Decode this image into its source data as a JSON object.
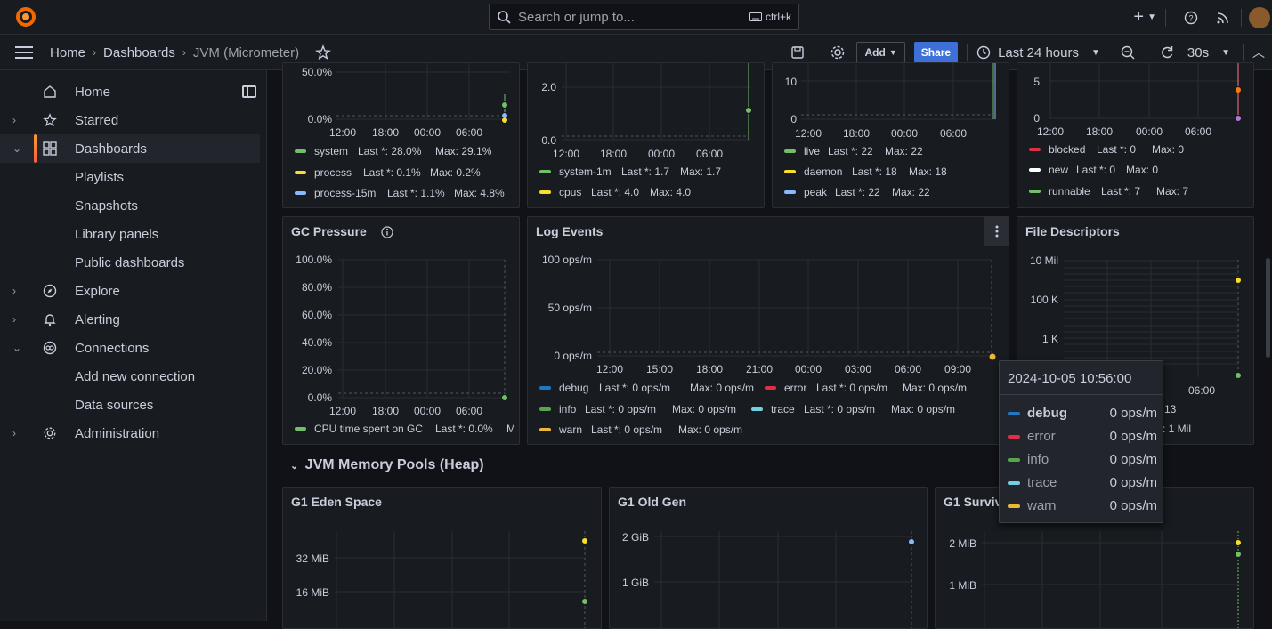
{
  "topbar": {
    "search_placeholder": "Search or jump to...",
    "search_shortcut": "ctrl+k"
  },
  "breadcrumb": {
    "home": "Home",
    "dashboards": "Dashboards",
    "current": "JVM (Micrometer)"
  },
  "toolbar": {
    "add_label": "Add",
    "share_label": "Share",
    "time_range": "Last 24 hours",
    "refresh_interval": "30s"
  },
  "sidebar": {
    "items": [
      {
        "label": "Home",
        "icon": "home-icon"
      },
      {
        "label": "Starred",
        "icon": "star-icon"
      },
      {
        "label": "Dashboards",
        "icon": "dashboards-icon"
      },
      {
        "label": "Playlists"
      },
      {
        "label": "Snapshots"
      },
      {
        "label": "Library panels"
      },
      {
        "label": "Public dashboards"
      },
      {
        "label": "Explore",
        "icon": "compass-icon"
      },
      {
        "label": "Alerting",
        "icon": "bell-icon"
      },
      {
        "label": "Connections",
        "icon": "connections-icon"
      },
      {
        "label": "Add new connection"
      },
      {
        "label": "Data sources"
      },
      {
        "label": "Administration",
        "icon": "gear-icon"
      }
    ]
  },
  "panels": {
    "cpu": {
      "yticks": [
        "50.0%",
        "0.0%"
      ],
      "xticks": [
        "12:00",
        "18:00",
        "00:00",
        "06:00"
      ],
      "legend": [
        {
          "name": "system",
          "last": "Last *: 28.0%",
          "max": "Max: 29.1%",
          "color": "#73bf69"
        },
        {
          "name": "process",
          "last": "Last *: 0.1%",
          "max": "Max: 0.2%",
          "color": "#fade2a"
        },
        {
          "name": "process-15m",
          "last": "Last *: 1.1%",
          "max": "Max: 4.8%",
          "color": "#8ab8ff"
        }
      ]
    },
    "load": {
      "yticks": [
        "2.0",
        "0.0"
      ],
      "xticks": [
        "12:00",
        "18:00",
        "00:00",
        "06:00"
      ],
      "legend": [
        {
          "name": "system-1m",
          "last": "Last *: 1.7",
          "max": "Max: 1.7",
          "color": "#73bf69"
        },
        {
          "name": "cpus",
          "last": "Last *: 4.0",
          "max": "Max: 4.0",
          "color": "#fade2a"
        }
      ]
    },
    "threads": {
      "yticks": [
        "10",
        "0"
      ],
      "xticks": [
        "12:00",
        "18:00",
        "00:00",
        "06:00"
      ],
      "legend": [
        {
          "name": "live",
          "last": "Last *: 22",
          "max": "Max: 22",
          "color": "#73bf69"
        },
        {
          "name": "daemon",
          "last": "Last *: 18",
          "max": "Max: 18",
          "color": "#fade2a"
        },
        {
          "name": "peak",
          "last": "Last *: 22",
          "max": "Max: 22",
          "color": "#8ab8ff"
        }
      ]
    },
    "thread_states": {
      "yticks": [
        "5",
        "0"
      ],
      "xticks": [
        "12:00",
        "18:00",
        "00:00",
        "06:00"
      ],
      "legend": [
        {
          "name": "blocked",
          "last": "Last *: 0",
          "max": "Max: 0",
          "color": "#e02f44"
        },
        {
          "name": "new",
          "last": "Last *: 0",
          "max": "Max: 0",
          "color": "#ffffff"
        },
        {
          "name": "runnable",
          "last": "Last *: 7",
          "max": "Max: 7",
          "color": "#73bf69"
        }
      ]
    },
    "gc": {
      "title": "GC Pressure",
      "yticks": [
        "100.0%",
        "80.0%",
        "60.0%",
        "40.0%",
        "20.0%",
        "0.0%"
      ],
      "xticks": [
        "12:00",
        "18:00",
        "00:00",
        "06:00"
      ],
      "legend": [
        {
          "name": "CPU time spent on GC",
          "last": "Last *: 0.0%",
          "max": "M",
          "color": "#73bf69"
        }
      ]
    },
    "log": {
      "title": "Log Events",
      "yticks": [
        "100 ops/m",
        "50 ops/m",
        "0 ops/m"
      ],
      "xticks": [
        "12:00",
        "15:00",
        "18:00",
        "21:00",
        "00:00",
        "03:00",
        "06:00",
        "09:00"
      ],
      "legend": [
        {
          "name": "debug",
          "last": "Last *: 0 ops/m",
          "max": "Max: 0 ops/m",
          "color": "#1f78c1"
        },
        {
          "name": "error",
          "last": "Last *: 0 ops/m",
          "max": "Max: 0 ops/m",
          "color": "#e02f44"
        },
        {
          "name": "info",
          "last": "Last *: 0 ops/m",
          "max": "Max: 0 ops/m",
          "color": "#56a64b"
        },
        {
          "name": "trace",
          "last": "Last *: 0 ops/m",
          "max": "Max: 0 ops/m",
          "color": "#6ed0e0"
        },
        {
          "name": "warn",
          "last": "Last *: 0 ops/m",
          "max": "Max: 0 ops/m",
          "color": "#eab839"
        }
      ]
    },
    "fd": {
      "title": "File Descriptors",
      "yticks": [
        "10 Mil",
        "100 K",
        "1 K"
      ],
      "xticks": [
        "0",
        "06:00"
      ],
      "legend_fragments": [
        "13",
        ": 1 Mil"
      ]
    },
    "row_title": "JVM Memory Pools (Heap)",
    "eden": {
      "title": "G1 Eden Space",
      "yticks": [
        "32 MiB",
        "16 MiB"
      ]
    },
    "oldgen": {
      "title": "G1 Old Gen",
      "yticks": [
        "2 GiB",
        "1 GiB"
      ]
    },
    "survivor": {
      "title": "G1 Surviv",
      "yticks": [
        "2 MiB",
        "1 MiB"
      ]
    }
  },
  "tooltip": {
    "time": "2024-10-05 10:56:00",
    "rows": [
      {
        "name": "debug",
        "value": "0 ops/m",
        "color": "#1f78c1"
      },
      {
        "name": "error",
        "value": "0 ops/m",
        "color": "#e02f44"
      },
      {
        "name": "info",
        "value": "0 ops/m",
        "color": "#56a64b"
      },
      {
        "name": "trace",
        "value": "0 ops/m",
        "color": "#6ed0e0"
      },
      {
        "name": "warn",
        "value": "0 ops/m",
        "color": "#eab839"
      }
    ]
  }
}
